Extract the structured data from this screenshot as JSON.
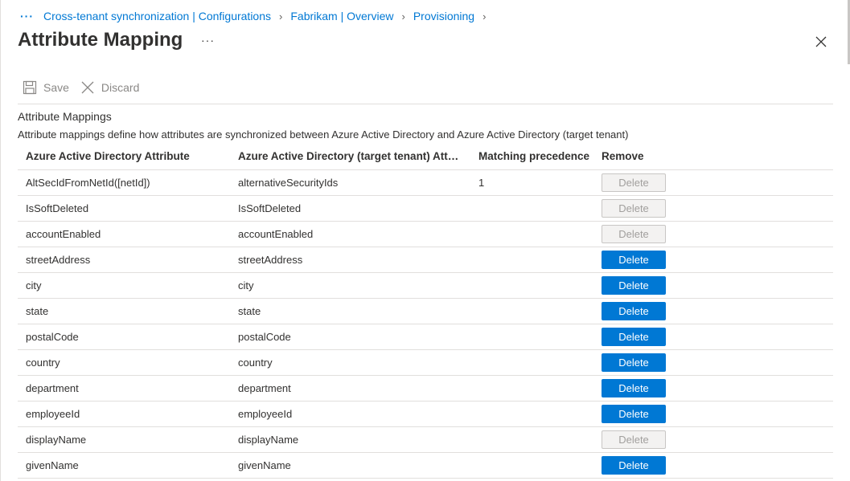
{
  "breadcrumb": {
    "more": "···",
    "items": [
      {
        "label": "Cross-tenant synchronization | Configurations"
      },
      {
        "label": "Fabrikam | Overview"
      },
      {
        "label": "Provisioning"
      }
    ]
  },
  "header": {
    "title": "Attribute Mapping",
    "more": "···"
  },
  "toolbar": {
    "save_label": "Save",
    "discard_label": "Discard"
  },
  "section": {
    "title": "Attribute Mappings",
    "description": "Attribute mappings define how attributes are synchronized between Azure Active Directory and Azure Active Directory (target tenant)"
  },
  "table": {
    "columns": [
      "Azure Active Directory Attribute",
      "Azure Active Directory (target tenant) Attribute",
      "Matching precedence",
      "Remove"
    ],
    "rows": [
      {
        "source": "AltSecIdFromNetId([netId])",
        "target": "alternativeSecurityIds",
        "precedence": "1",
        "action": "Delete",
        "enabled": false
      },
      {
        "source": "IsSoftDeleted",
        "target": "IsSoftDeleted",
        "precedence": "",
        "action": "Delete",
        "enabled": false
      },
      {
        "source": "accountEnabled",
        "target": "accountEnabled",
        "precedence": "",
        "action": "Delete",
        "enabled": false
      },
      {
        "source": "streetAddress",
        "target": "streetAddress",
        "precedence": "",
        "action": "Delete",
        "enabled": true
      },
      {
        "source": "city",
        "target": "city",
        "precedence": "",
        "action": "Delete",
        "enabled": true
      },
      {
        "source": "state",
        "target": "state",
        "precedence": "",
        "action": "Delete",
        "enabled": true
      },
      {
        "source": "postalCode",
        "target": "postalCode",
        "precedence": "",
        "action": "Delete",
        "enabled": true
      },
      {
        "source": "country",
        "target": "country",
        "precedence": "",
        "action": "Delete",
        "enabled": true
      },
      {
        "source": "department",
        "target": "department",
        "precedence": "",
        "action": "Delete",
        "enabled": true
      },
      {
        "source": "employeeId",
        "target": "employeeId",
        "precedence": "",
        "action": "Delete",
        "enabled": true
      },
      {
        "source": "displayName",
        "target": "displayName",
        "precedence": "",
        "action": "Delete",
        "enabled": false
      },
      {
        "source": "givenName",
        "target": "givenName",
        "precedence": "",
        "action": "Delete",
        "enabled": true
      }
    ]
  },
  "colors": {
    "accent": "#0078d4",
    "disabled_bg": "#f3f2f1",
    "disabled_text": "#a19f9d"
  }
}
